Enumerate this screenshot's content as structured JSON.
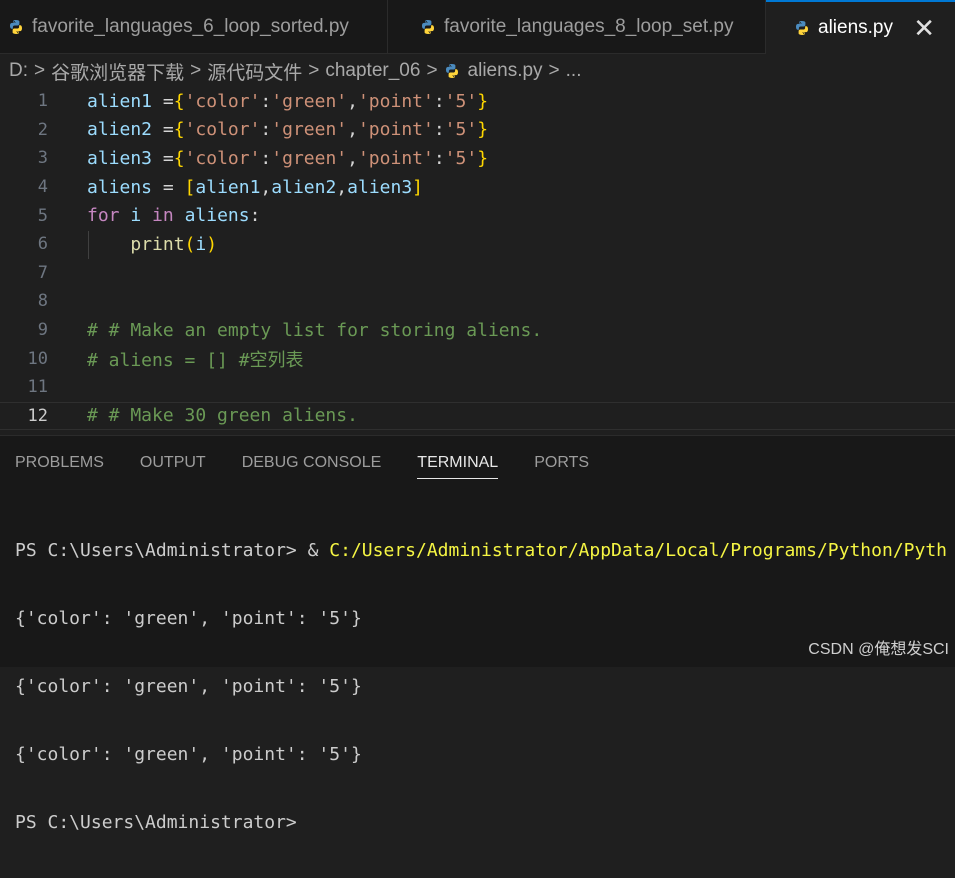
{
  "tabs": [
    {
      "label": "favorite_languages_6_loop_sorted.py"
    },
    {
      "label": "favorite_languages_8_loop_set.py"
    },
    {
      "label": "aliens.py",
      "close": "✕"
    }
  ],
  "breadcrumb": {
    "drive": "D:",
    "folder1": "谷歌浏览器下载",
    "folder2": "源代码文件",
    "folder3": "chapter_06",
    "file": "aliens.py",
    "more": "..."
  },
  "code": {
    "lines": [
      {
        "n": "1",
        "t": [
          "alien1",
          " =",
          "{",
          "'color'",
          ":",
          "'green'",
          ",",
          "'point'",
          ":",
          "'5'",
          "}"
        ]
      },
      {
        "n": "2",
        "t": [
          "alien2",
          " =",
          "{",
          "'color'",
          ":",
          "'green'",
          ",",
          "'point'",
          ":",
          "'5'",
          "}"
        ]
      },
      {
        "n": "3",
        "t": [
          "alien3",
          " =",
          "{",
          "'color'",
          ":",
          "'green'",
          ",",
          "'point'",
          ":",
          "'5'",
          "}"
        ]
      },
      {
        "n": "4",
        "t": [
          "aliens",
          " = ",
          "[",
          "alien1",
          ",",
          "alien2",
          ",",
          "alien3",
          "]"
        ]
      },
      {
        "n": "5",
        "t": [
          "for",
          " ",
          "i",
          " ",
          "in",
          " ",
          "aliens",
          ":"
        ]
      },
      {
        "n": "6",
        "t": [
          "    ",
          "print",
          "(",
          "i",
          ")"
        ]
      },
      {
        "n": "7",
        "t": []
      },
      {
        "n": "8",
        "t": []
      },
      {
        "n": "9",
        "t": [
          "# # Make an empty list for storing aliens."
        ]
      },
      {
        "n": "10",
        "t": [
          "# aliens = [] #空列表"
        ]
      },
      {
        "n": "11",
        "t": []
      },
      {
        "n": "12",
        "t": [
          "# # Make 30 green aliens."
        ]
      }
    ]
  },
  "panel": {
    "tabs": [
      "PROBLEMS",
      "OUTPUT",
      "DEBUG CONSOLE",
      "TERMINAL",
      "PORTS"
    ],
    "terminal": {
      "prompt": "PS C:\\Users\\Administrator> ",
      "amp": "& ",
      "command": "C:/Users/Administrator/AppData/Local/Programs/Python/Pyth",
      "out1": "{'color': 'green', 'point': '5'}",
      "out2": "{'color': 'green', 'point': '5'}",
      "out3": "{'color': 'green', 'point': '5'}",
      "prompt2": "PS C:\\Users\\Administrator>"
    }
  },
  "watermark": "CSDN @俺想发SCI"
}
